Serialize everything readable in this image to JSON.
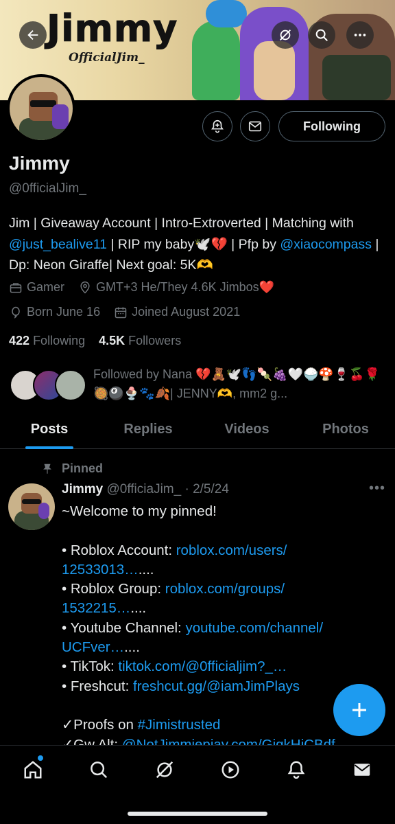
{
  "banner": {
    "logo_text": "Jimmy",
    "logo_subtext": "OfficialJim_"
  },
  "profile": {
    "name": "Jimmy",
    "handle": "@0fficialJim_",
    "follow_button": "Following",
    "bio_parts": {
      "p1": "Jim | Giveaway Account | Intro-Extroverted | Matching with ",
      "link1": "@just_bealive11",
      "p2": " | RIP my baby🕊️💔 | Pfp by ",
      "link2": "@xiaocompass",
      "p3": " | Dp: Neon Giraffe| Next goal: 5K🫶"
    },
    "category": "Gamer",
    "location": "GMT+3 He/They 4.6K Jimbos❤️",
    "birthday": "Born June 16",
    "joined": "Joined August 2021",
    "following_count": "422",
    "following_label": "Following",
    "followers_count": "4.5K",
    "followers_label": "Followers",
    "followed_by": "Followed by Nana 💔🧸🕊️👣🍡🍇🤍🍚🍄🍷🍒🌹🥘🎱🍨🐾🍂| JENNY🫶, mm2 g..."
  },
  "tabs": [
    {
      "label": "Posts",
      "active": true
    },
    {
      "label": "Replies",
      "active": false
    },
    {
      "label": "Videos",
      "active": false
    },
    {
      "label": "Photos",
      "active": false
    }
  ],
  "post": {
    "pinned_label": "Pinned",
    "author": "Jimmy",
    "meta": "@0fficiaJim_ · 2/5/24",
    "lines": {
      "l1": "~Welcome to my pinned!",
      "l2_pre": "• Roblox Account: ",
      "l2_link": "roblox.com/users/",
      "l3_link": "12533013…",
      "l3_post": "....",
      "l4_pre": "• Roblox Group: ",
      "l4_link": "roblox.com/groups/",
      "l5_link": "1532215…",
      "l5_post": "....",
      "l6_pre": "• Youtube Channel: ",
      "l6_link": "youtube.com/channel/",
      "l7_link": "UCFver…",
      "l7_post": "....",
      "l8_pre": "• TikTok: ",
      "l8_link": "tiktok.com/@0fficialjim?_…",
      "l9_pre": "• Freshcut: ",
      "l9_link": "freshcut.gg/@iamJimPlays",
      "l10_pre": "✓Proofs on ",
      "l10_link": "#Jimistrusted",
      "l11_pre": "✓Gw Alt: ",
      "l11_link": "@NotJimmiepiay.com/GiqkHiCBdf"
    }
  },
  "colors": {
    "accent": "#1d9bf0",
    "muted": "#71767b",
    "text": "#e7e9ea",
    "background": "#000000"
  }
}
